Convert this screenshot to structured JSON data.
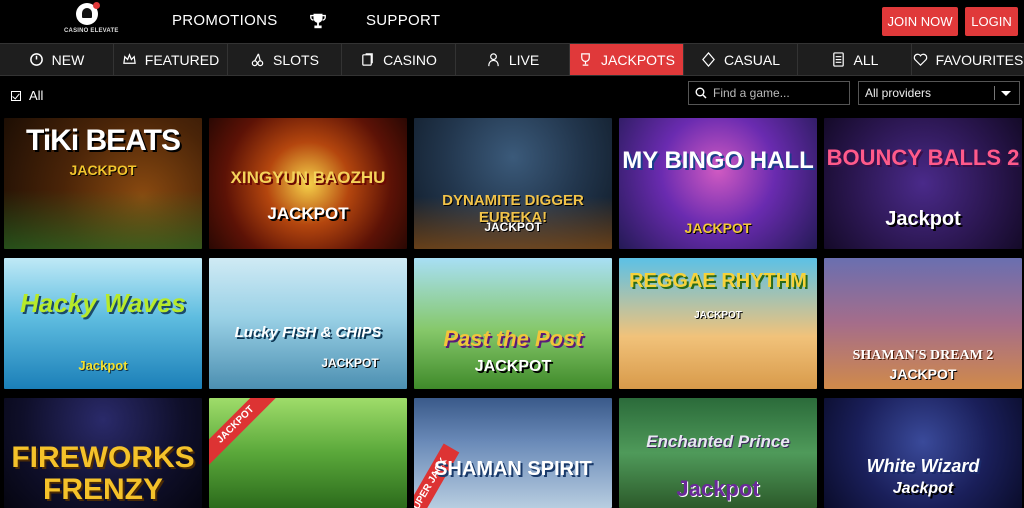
{
  "brand": {
    "name": "CASINO ELEVATE"
  },
  "header": {
    "promotions": "PROMOTIONS",
    "support": "SUPPORT",
    "join": "JOIN NOW",
    "login": "LOGIN"
  },
  "categories": [
    {
      "label": "NEW",
      "icon": "new-icon"
    },
    {
      "label": "FEATURED",
      "icon": "crown-icon"
    },
    {
      "label": "SLOTS",
      "icon": "cherries-icon"
    },
    {
      "label": "CASINO",
      "icon": "cards-icon"
    },
    {
      "label": "LIVE",
      "icon": "dealer-icon"
    },
    {
      "label": "JACKPOTS",
      "icon": "trophy-icon",
      "active": true
    },
    {
      "label": "CASUAL",
      "icon": "diamond-icon"
    },
    {
      "label": "ALL",
      "icon": "list-icon"
    },
    {
      "label": "FAVOURITES",
      "icon": "heart-icon"
    }
  ],
  "filters": {
    "all_label": "All",
    "search_placeholder": "Find a game...",
    "provider_selected": "All providers"
  },
  "games": [
    {
      "title": "TiKi BEATS",
      "jackpot": "JACKPOT"
    },
    {
      "title": "XINGYUN BAOZHU",
      "jackpot": "JACKPOT"
    },
    {
      "title": "DYNAMITE DIGGER EUREKA!",
      "jackpot": "JACKPOT"
    },
    {
      "title": "MY BINGO HALL",
      "jackpot": "JACKPOT"
    },
    {
      "title": "BOUNCY BALLS 2",
      "jackpot": "Jackpot"
    },
    {
      "title": "Hacky Waves",
      "jackpot": "Jackpot"
    },
    {
      "title": "Lucky FISH & CHIPS",
      "jackpot": "JACKPOT"
    },
    {
      "title": "Past the Post",
      "jackpot": "JACKPOT"
    },
    {
      "title": "REGGAE RHYTHM",
      "jackpot": "JACKPOT"
    },
    {
      "title": "SHAMAN'S DREAM 2",
      "jackpot": "JACKPOT"
    },
    {
      "title": "FIREWORKS FRENZY",
      "jackpot": ""
    },
    {
      "title": "",
      "jackpot": "",
      "ribbon": "JACKPOT"
    },
    {
      "title": "SHAMAN SPIRIT",
      "jackpot": "",
      "ribbon": "SUPER JACK"
    },
    {
      "title": "Enchanted Prince",
      "jackpot": "Jackpot"
    },
    {
      "title": "White Wizard",
      "jackpot": "Jackpot"
    }
  ]
}
